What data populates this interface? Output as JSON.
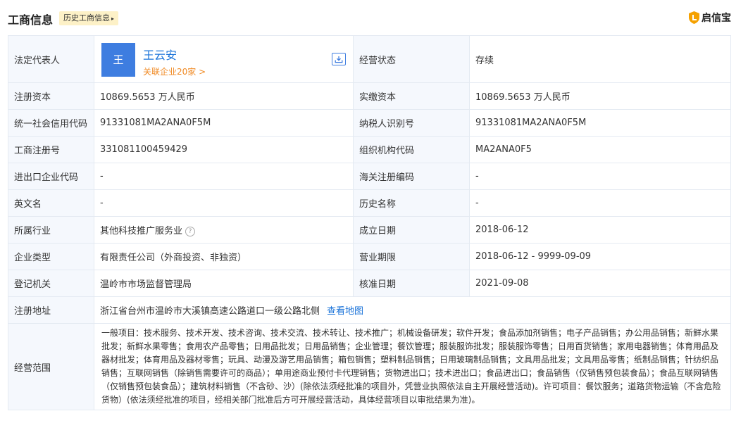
{
  "header": {
    "title": "工商信息",
    "history_label": "历史工商信息",
    "brand": "启信宝"
  },
  "legal": {
    "label": "法定代表人",
    "avatar_char": "王",
    "name": "王云安",
    "related": "关联企业20家 >",
    "status_label": "经营状态",
    "status_value": "存续"
  },
  "rows": [
    {
      "l1": "注册资本",
      "v1": "10869.5653 万人民币",
      "l2": "实缴资本",
      "v2": "10869.5653 万人民币"
    },
    {
      "l1": "统一社会信用代码",
      "v1": "91331081MA2ANA0F5M",
      "l2": "纳税人识别号",
      "v2": "91331081MA2ANA0F5M"
    },
    {
      "l1": "工商注册号",
      "v1": "331081100459429",
      "l2": "组织机构代码",
      "v2": "MA2ANA0F5"
    },
    {
      "l1": "进出口企业代码",
      "v1": "-",
      "l2": "海关注册编码",
      "v2": "-"
    },
    {
      "l1": "英文名",
      "v1": "-",
      "l2": "历史名称",
      "v2": "-"
    },
    {
      "l1": "所属行业",
      "v1": "其他科技推广服务业",
      "l2": "成立日期",
      "v2": "2018-06-12"
    },
    {
      "l1": "企业类型",
      "v1": "有限责任公司（外商投资、非独资）",
      "l2": "营业期限",
      "v2": "2018-06-12 - 9999-09-09"
    },
    {
      "l1": "登记机关",
      "v1": "温岭市市场监督管理局",
      "l2": "核准日期",
      "v2": "2021-09-08"
    }
  ],
  "address": {
    "label": "注册地址",
    "value": "浙江省台州市温岭市大溪镇高速公路道口一级公路北侧",
    "map_link": "查看地图"
  },
  "scope": {
    "label": "经营范围",
    "value": "一般项目：技术服务、技术开发、技术咨询、技术交流、技术转让、技术推广；机械设备研发；软件开发；食品添加剂销售；电子产品销售；办公用品销售；新鲜水果批发；新鲜水果零售；食用农产品零售；日用品批发；日用品销售；企业管理；餐饮管理；服装服饰批发；服装服饰零售；日用百货销售；家用电器销售；体育用品及器材批发；体育用品及器材零售；玩具、动漫及游艺用品销售；箱包销售；塑料制品销售；日用玻璃制品销售；文具用品批发；文具用品零售；纸制品销售；针纺织品销售；互联网销售（除销售需要许可的商品）；单用途商业预付卡代理销售；货物进出口；技术进出口；食品进出口；食品销售（仅销售预包装食品）；食品互联网销售（仅销售预包装食品）；建筑材料销售（不含砂、沙）(除依法须经批准的项目外，凭营业执照依法自主开展经营活动)。许可项目：餐饮服务；道路货物运输（不含危险货物）(依法须经批准的项目，经相关部门批准后方可开展经营活动，具体经营项目以审批结果为准)。"
  }
}
